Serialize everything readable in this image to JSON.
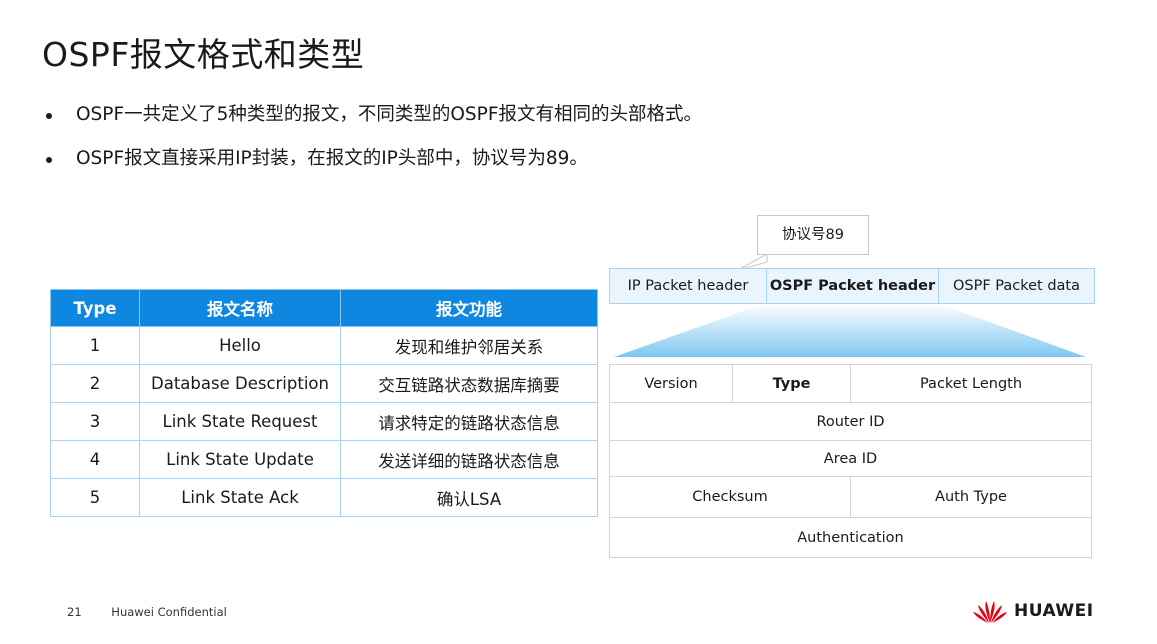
{
  "title": "OSPF报文格式和类型",
  "bullets": [
    "OSPF一共定义了5种类型的报文，不同类型的OSPF报文有相同的头部格式。",
    "OSPF报文直接采用IP封装，在报文的IP头部中，协议号为89。"
  ],
  "table": {
    "headers": [
      "Type",
      "报文名称",
      "报文功能"
    ],
    "rows": [
      [
        "1",
        "Hello",
        "发现和维护邻居关系"
      ],
      [
        "2",
        "Database Description",
        "交互链路状态数据库摘要"
      ],
      [
        "3",
        "Link State Request",
        "请求特定的链路状态信息"
      ],
      [
        "4",
        "Link State Update",
        "发送详细的链路状态信息"
      ],
      [
        "5",
        "Link State Ack",
        "确认LSA"
      ]
    ]
  },
  "callout": "协议号89",
  "packet": [
    "IP Packet header",
    "OSPF Packet header",
    "OSPF Packet data"
  ],
  "header_fields": {
    "version": "Version",
    "type": "Type",
    "packet_length": "Packet Length",
    "router_id": "Router ID",
    "area_id": "Area ID",
    "checksum": "Checksum",
    "auth_type": "Auth Type",
    "authentication": "Authentication"
  },
  "footer": {
    "page": "21",
    "confidential": "Huawei Confidential"
  },
  "logo_text": "HUAWEI",
  "colors": {
    "table_header": "#0d87e0",
    "border": "#a9d3f4",
    "logo_red": "#e60012"
  }
}
